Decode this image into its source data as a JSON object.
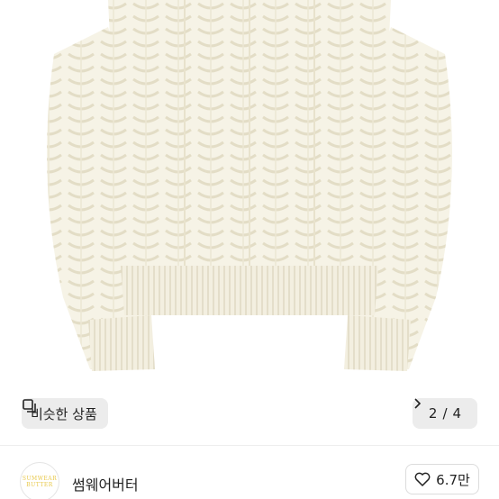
{
  "image_carousel": {
    "similar_label": "비슷한 상품",
    "current_page": "2",
    "separator": "/",
    "total_pages": "4"
  },
  "shop": {
    "avatar_text": "SUMWEAR BUTTER",
    "name": "썸웨어버터",
    "like_count": "6.7만"
  },
  "colors": {
    "sweater": "#f6f3e6",
    "button_bg": "#ececec"
  }
}
